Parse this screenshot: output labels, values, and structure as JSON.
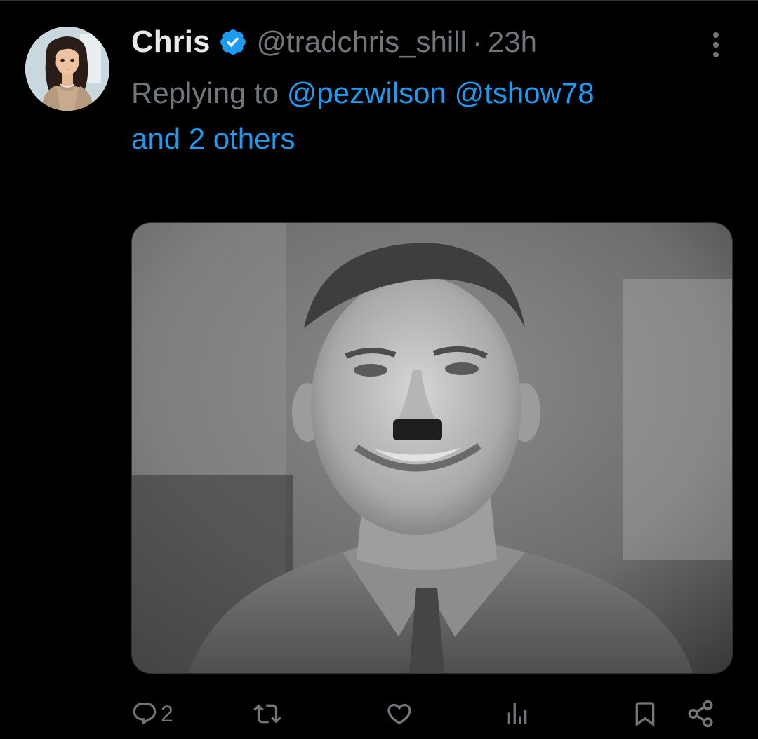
{
  "tweet": {
    "author": {
      "display_name": "Chris",
      "handle": "@tradchris_shill",
      "verified": true,
      "avatar_icon": "avatar-woman-illustration"
    },
    "separator": "·",
    "time": "23h",
    "reply": {
      "prefix": "Replying to",
      "mention_1": "@pezwilson",
      "mention_2": "@tshow78",
      "others": "and 2 others"
    },
    "media": {
      "type": "photo",
      "style": "black-and-white"
    },
    "actions": {
      "reply_icon": "reply-icon",
      "reply_count": "2",
      "retweet_icon": "retweet-icon",
      "like_icon": "heart-icon",
      "views_icon": "bar-chart-icon",
      "bookmark_icon": "bookmark-icon",
      "share_icon": "share-icon"
    }
  },
  "colors": {
    "background": "#000000",
    "primary_text": "#e7e9ea",
    "secondary_text": "#71767b",
    "accent": "#1d9bf0"
  }
}
